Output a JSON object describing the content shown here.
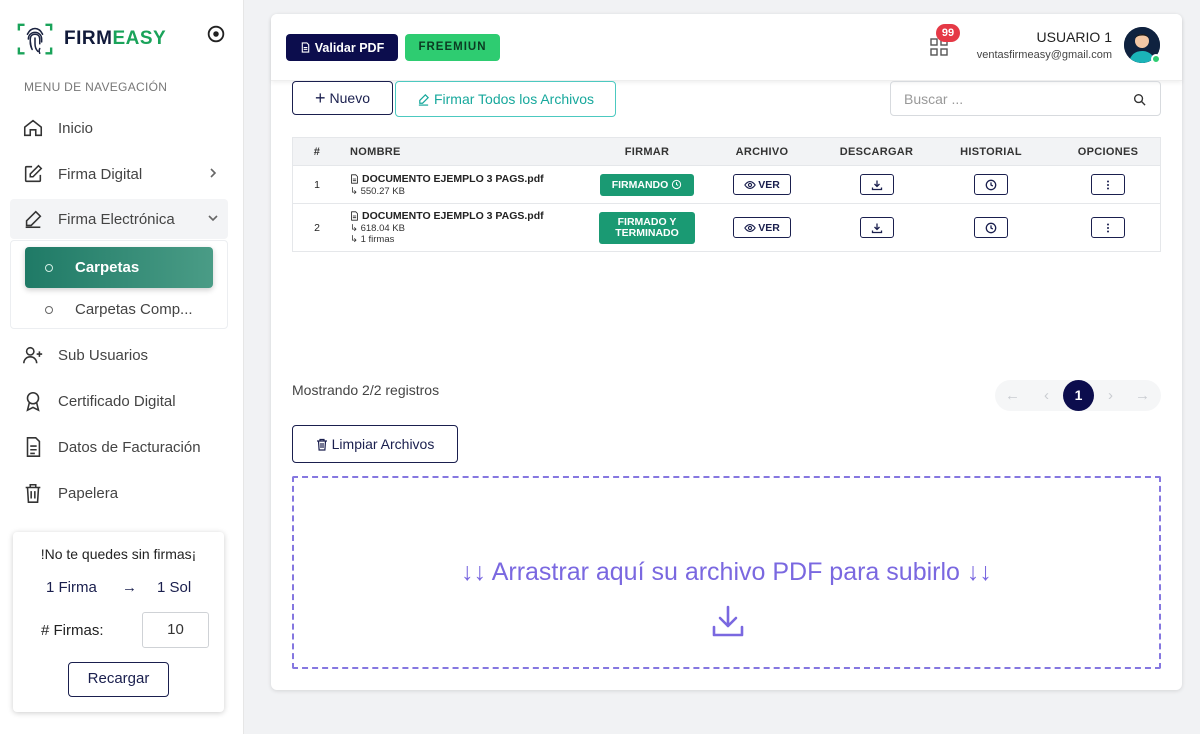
{
  "brand": {
    "part1": "FIRM",
    "part2": "EASY"
  },
  "sidebar": {
    "nav_header": "MENU DE NAVEGACIÓN",
    "items": [
      {
        "label": "Inicio",
        "icon": "home-icon"
      },
      {
        "label": "Firma Digital",
        "icon": "edit-square-icon"
      },
      {
        "label": "Firma Electrónica",
        "icon": "pen-icon"
      },
      {
        "label": "Sub Usuarios",
        "icon": "user-plus-icon"
      },
      {
        "label": "Certificado Digital",
        "icon": "award-icon"
      },
      {
        "label": "Datos de Facturación",
        "icon": "document-icon"
      },
      {
        "label": "Papelera",
        "icon": "trash-icon"
      }
    ],
    "submenu": [
      {
        "label": "Carpetas",
        "active": true
      },
      {
        "label": "Carpetas Comp..."
      }
    ],
    "promo": {
      "title": "!No te quedes sin firmas¡",
      "left": "1 Firma",
      "arrow": "→",
      "right": "1 Sol",
      "label": "# Firmas:",
      "input_value": "10",
      "button": "Recargar"
    }
  },
  "topbar": {
    "validar_label": "Validar PDF",
    "plan_label": "FREEMIUN",
    "notification_count": "99",
    "user_name": "USUARIO 1",
    "user_email": "ventasfirmeasy@gmail.com"
  },
  "toolbar": {
    "nuevo_label": "Nuevo",
    "firmar_todos_label": "Firmar Todos los Archivos",
    "search_placeholder": "Buscar ..."
  },
  "table": {
    "columns": [
      "#",
      "NOMBRE",
      "FIRMAR",
      "ARCHIVO",
      "DESCARGAR",
      "HISTORIAL",
      "OPCIONES"
    ],
    "rows": [
      {
        "num": "1",
        "name": "DOCUMENTO EJEMPLO 3 PAGS.pdf",
        "size": "↳ 550.27 KB",
        "firmas": "",
        "status": "FIRMANDO",
        "ver": "VER"
      },
      {
        "num": "2",
        "name": "DOCUMENTO EJEMPLO 3 PAGS.pdf",
        "size": "↳ 618.04 KB",
        "firmas": "↳ 1 firmas",
        "status": "FIRMADO Y TERMINADO",
        "ver": "VER"
      }
    ]
  },
  "pagination": {
    "showing": "Mostrando 2/2 registros",
    "current_page": "1",
    "first": "←",
    "prev": "‹",
    "next": "›",
    "last": "→"
  },
  "limpiar_label": "Limpiar Archivos",
  "dropzone_text": "↓↓ Arrastrar aquí su archivo PDF para subirlo ↓↓"
}
